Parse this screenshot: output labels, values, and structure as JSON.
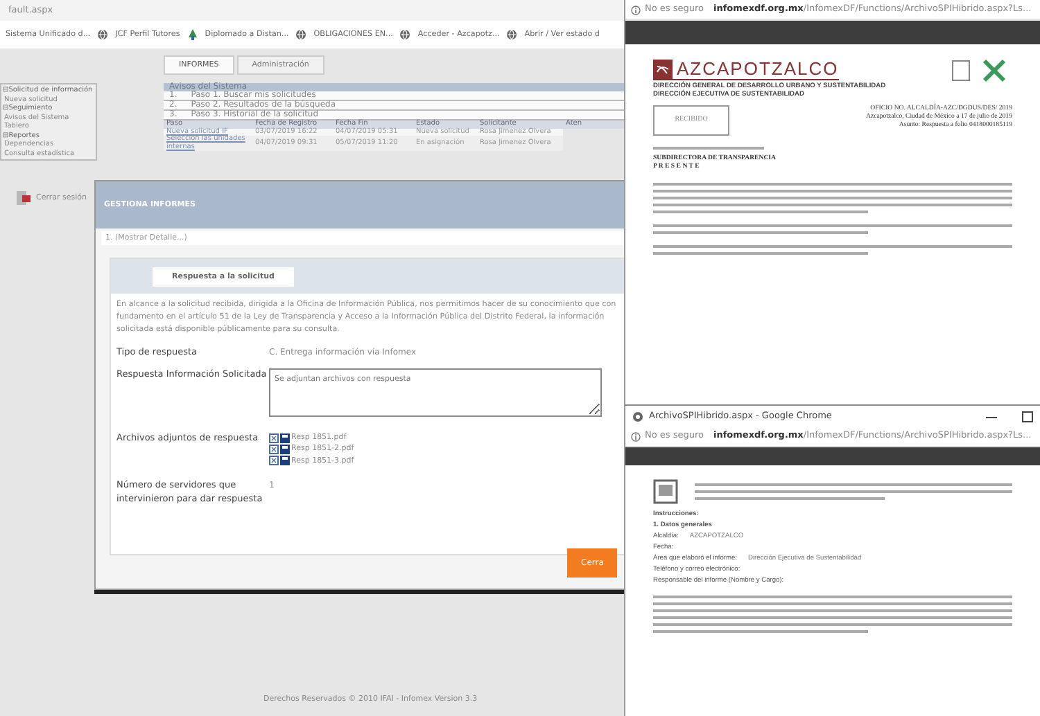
{
  "browser": {
    "page_url": "fault.aspx",
    "bookmarks": [
      {
        "label": "Sistema Unificado d...",
        "kind": "none"
      },
      {
        "label": "JCF Perfil Tutores",
        "kind": "globe"
      },
      {
        "label": "Diplomado a Distan...",
        "kind": "app"
      },
      {
        "label": "OBLIGACIONES EN...",
        "kind": "globe"
      },
      {
        "label": "Acceder - Azcapotz...",
        "kind": "globe"
      },
      {
        "label": "Abrir / Ver estado d",
        "kind": "globe"
      }
    ]
  },
  "app": {
    "tabs": [
      {
        "label": "INFORMES",
        "selected": true
      },
      {
        "label": "Administración",
        "selected": false
      }
    ],
    "sidebar": [
      {
        "label": "⊟Solicitud de información",
        "kind": "group"
      },
      {
        "label": "Nueva solicitud",
        "kind": "item"
      },
      {
        "label": "⊟Seguimiento",
        "kind": "group"
      },
      {
        "label": "Avisos del Sistema",
        "kind": "item"
      },
      {
        "label": "Tablero",
        "kind": "item"
      },
      {
        "label": "⊟Reportes",
        "kind": "group"
      },
      {
        "label": "Dependencias",
        "kind": "item"
      },
      {
        "label": "Consulta estadística",
        "kind": "item"
      }
    ],
    "logout": "Cerrar sesión",
    "notices": {
      "title": "Avisos del Sistema",
      "steps": [
        {
          "number": "1.",
          "label": "Paso 1. Buscar mis solicitudes"
        },
        {
          "number": "2.",
          "label": "Paso 2. Resultados de la búsqueda"
        },
        {
          "number": "3.",
          "label": "Paso 3. Historial de la solicitud"
        }
      ]
    },
    "table": {
      "columns": [
        "Paso",
        "Fecha de Registro",
        "Fecha Fin",
        "Estado",
        "Solicitante",
        "Aten"
      ],
      "rows": [
        [
          "Nueva solicitud IF",
          "03/07/2019 16:22",
          "04/07/2019 05:31",
          "Nueva solicitud",
          "Rosa Jimenez Olvera"
        ],
        [
          "Seleccion las unidades internas",
          "04/07/2019 09:31",
          "05/07/2019 11:20",
          "En asignación",
          "Rosa Jimenez Olvera"
        ]
      ]
    },
    "footer": "Derechos Reservados © 2010 IFAI - Infomex Version 3.3"
  },
  "modal": {
    "title": "GESTIONA INFORMES",
    "detail_toggle": "1. (Mostrar Detalle...)",
    "tab": "Respuesta a la solicitud",
    "intro": "En alcance a la solicitud recibida, dirigida a la Oficina de Información Pública, nos permitimos hacer de su conocimiento que con fundamento en el artículo 51 de la Ley de Transparencia y Acceso a la Información Pública del Distrito Federal, la información solicitada está disponible públicamente para su consulta.",
    "fields": [
      {
        "label": "Tipo de respuesta",
        "kind": "text",
        "value": "C. Entrega información vía Infomex"
      },
      {
        "label": "Respuesta Información Solicitada",
        "kind": "textarea",
        "value": "Se adjuntan archivos con respuesta"
      },
      {
        "label": "Archivos adjuntos de respuesta",
        "kind": "files",
        "files": [
          "Resp 1851.pdf",
          "Resp 1851-2.pdf",
          "Resp 1851-3.pdf"
        ]
      },
      {
        "label": "Número de servidores que intervinieron para dar respuesta",
        "kind": "text",
        "value": "1"
      }
    ],
    "button": "Cerra"
  },
  "viewer_top": {
    "security": "No es seguro",
    "url": "**infomexdf.org.mx**/InfomexDF/Functions/ArchivoSPIHibrido.aspx?Ls...",
    "document": {
      "logo_text": "AZCAPOTZALCO",
      "stamp": "RECIBIDO",
      "headings": [
        "DIRECCIÓN GENERAL DE DESARROLLO URBANO Y SUSTENTABILIDAD",
        "DIRECCIÓN EJECUTIVA DE SUSTENTABILIDAD"
      ],
      "reference": [
        "OFICIO NO. ALCALDÍA-AZC/DGDUS/DES/ 2019",
        "Azcapotzalco, Ciudad de México a 17 de julio de 2019",
        "Asunto: Respuesta a folio 0418000185119"
      ],
      "addressee": [
        "SUBDIRECTORA DE TRANSPARENCIA",
        "P R E S E N T E"
      ]
    }
  },
  "viewer_bottom": {
    "title": "ArchivoSPIHibrido.aspx - Google Chrome",
    "security": "No es seguro",
    "url": "**infomexdf.org.mx**/InfomexDF/Functions/ArchivoSPIHibrido.aspx?Ls...",
    "document": {
      "lines": [
        {
          "kind": "heading",
          "label": "Instrucciones:"
        },
        {
          "kind": "heading",
          "label": "1. Datos generales"
        },
        {
          "kind": "entry",
          "label": "Alcaldía:",
          "value": "AZCAPOTZALCO"
        },
        {
          "kind": "entry",
          "label": "Fecha:"
        },
        {
          "kind": "entry",
          "label": "Área que elaboró el informe:",
          "value": "Dirección Ejecutiva de Sustentabilidad"
        },
        {
          "kind": "entry",
          "label": "Teléfono y correo electrónico:"
        },
        {
          "kind": "entry",
          "label": "Responsable del informe (Nombre y Cargo):"
        }
      ]
    }
  }
}
